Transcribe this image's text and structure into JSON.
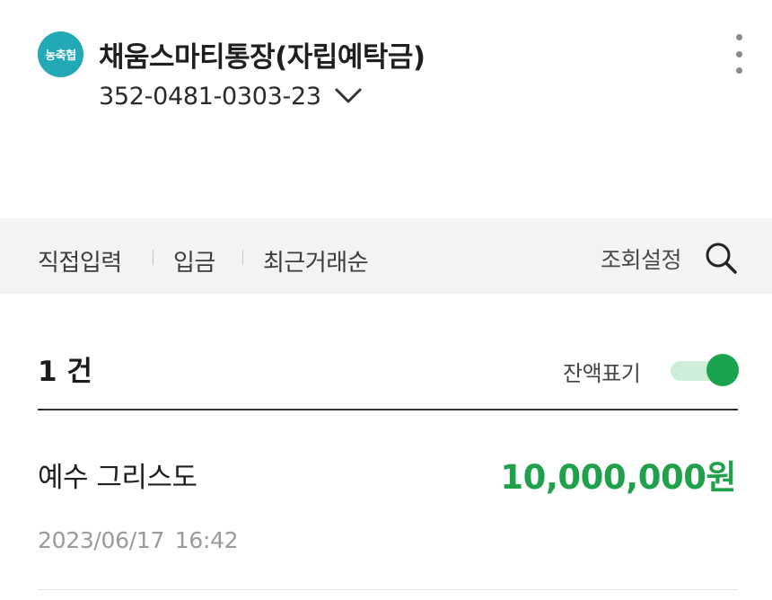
{
  "account": {
    "bank_logo_text": "농축협",
    "name": "채움스마티통장(자립예탁금)",
    "number": "352-0481-0303-23"
  },
  "filters": {
    "direct_input": "직접입력",
    "deposit": "입금",
    "recent_order": "최근거래순",
    "query_settings": "조회설정"
  },
  "summary": {
    "count": "1 건",
    "balance_display_label": "잔액표기",
    "balance_display_on": true
  },
  "transactions": [
    {
      "name": "예수 그리스도",
      "amount": "10,000,000원",
      "datetime": "2023/06/17  16:42"
    }
  ],
  "colors": {
    "accent_green": "#1fa14a",
    "logo_teal": "#22a9b5",
    "filter_bar_bg": "#f2f3f5"
  },
  "icons": [
    "chevron-down-icon",
    "more-vertical-icon",
    "search-icon"
  ]
}
